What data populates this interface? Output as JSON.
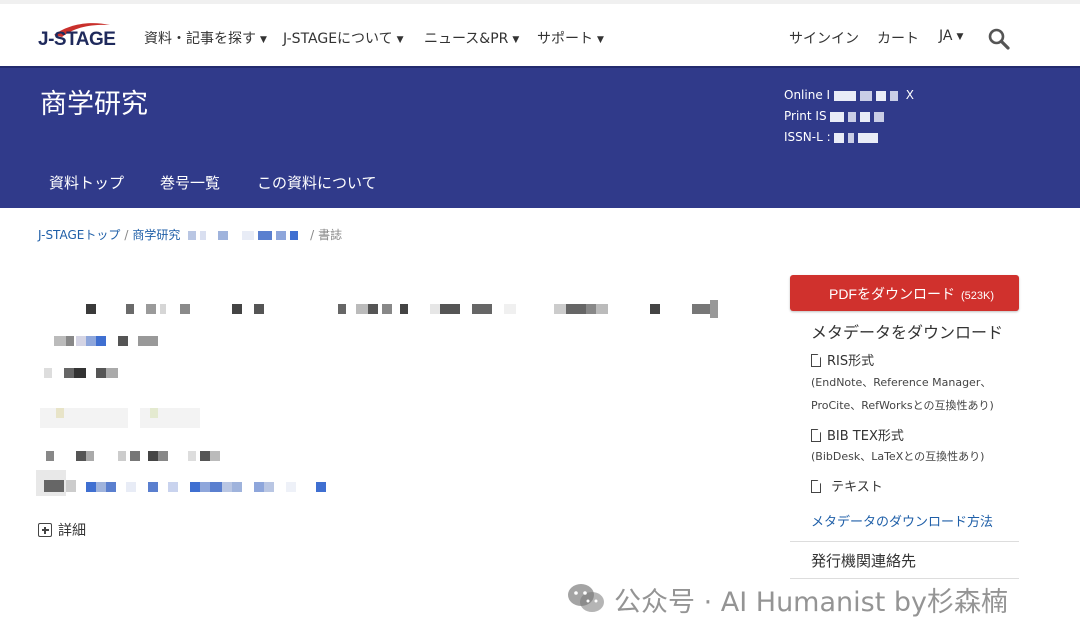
{
  "header": {
    "logo_text": "J-STAGE",
    "nav": [
      {
        "label": "資料・記事を探す",
        "has_caret": true
      },
      {
        "label": "J-STAGEについて",
        "has_caret": true
      },
      {
        "label": "ニュース&PR",
        "has_caret": true
      },
      {
        "label": "サポート",
        "has_caret": true
      }
    ],
    "signin": "サインイン",
    "cart": "カート",
    "lang": "JA"
  },
  "banner": {
    "journal_title": "商学研究",
    "issn_online_label": "Online I",
    "issn_online_suffix": "X",
    "issn_print_label": "Print IS",
    "issn_l_label": "ISSN-L :",
    "subnav": [
      "資料トップ",
      "巻号一覧",
      "この資料について"
    ]
  },
  "breadcrumb": {
    "top": "J-STAGEトップ",
    "journal": "商学研究",
    "current": "書誌"
  },
  "article": {
    "details_label": "詳細"
  },
  "sidebar": {
    "pdf_label": "PDFをダウンロード",
    "pdf_size": "(523K)",
    "meta_title": "メタデータをダウンロード",
    "ris": "RIS形式",
    "ris_note_1": "(EndNote、Reference Manager、",
    "ris_note_2": "ProCite、RefWorksとの互換性あり)",
    "bibtex": "BIB TEX形式",
    "bibtex_note": "(BibDesk、LaTeXとの互換性あり)",
    "text": "テキスト",
    "method_link": "メタデータのダウンロード方法",
    "publisher": "発行機関連絡先"
  },
  "watermark": {
    "text": "公众号 · AI Humanist by杉森楠"
  },
  "colors": {
    "banner": "#303a8a",
    "pdf_button": "#d0312d",
    "link": "#1f5fa8"
  }
}
